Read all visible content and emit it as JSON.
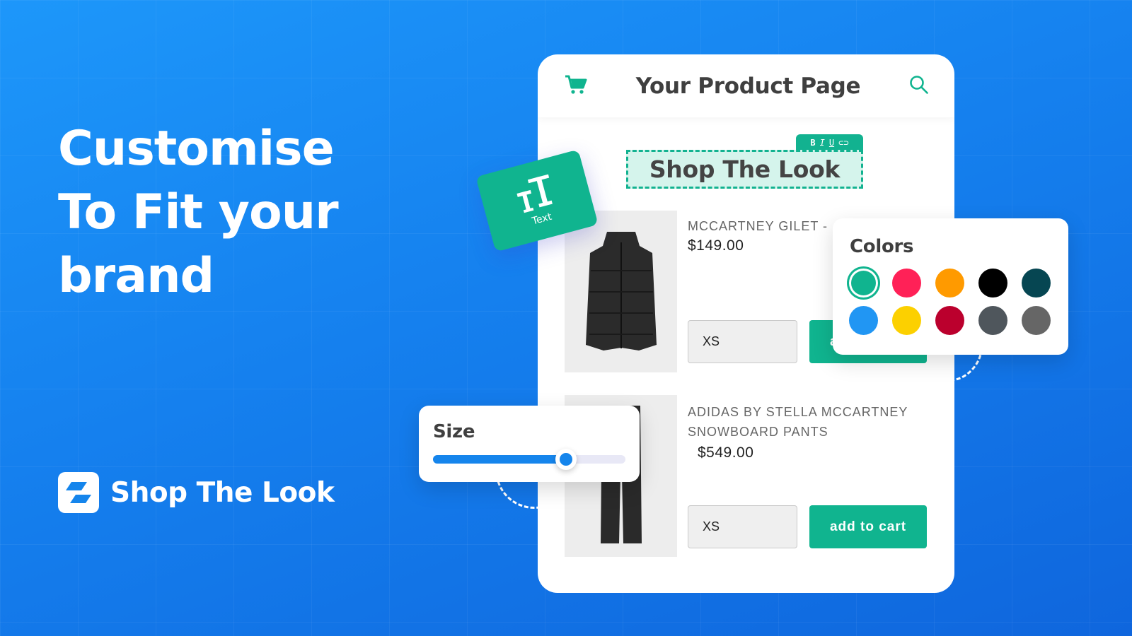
{
  "headline": [
    "Customise",
    "To Fit your",
    "brand"
  ],
  "brand": {
    "name": "Shop The Look",
    "icon": "shop-the-look-logo"
  },
  "product_page": {
    "title": "Your Product Page",
    "cart_icon": "cart-icon",
    "search_icon": "search-icon",
    "section_title": "Shop The Look",
    "toolbar": {
      "bold": "B",
      "italic": "I",
      "underline": "U",
      "link": "link-icon"
    },
    "products": [
      {
        "name_lines": [
          "MCCARTNEY GILET -"
        ],
        "price": "$149.00",
        "size": "XS",
        "button": "add to cart",
        "image": "black puffer gilet"
      },
      {
        "name_lines": [
          "ADIDAS BY STELLA MCCARTNEY",
          "SNOWBOARD PANTS"
        ],
        "price": "$549.00",
        "size": "XS",
        "button": "add to cart",
        "image": "black snowboard pants"
      }
    ]
  },
  "text_widget": {
    "label": "Text",
    "icon": "text-size-icon"
  },
  "colors_panel": {
    "title": "Colors",
    "selected": 0,
    "swatches": [
      "#10b48f",
      "#ff2157",
      "#ff9a00",
      "#000000",
      "#064652",
      "#2196f3",
      "#fcd000",
      "#bb002d",
      "#4f565c",
      "#666666"
    ]
  },
  "size_panel": {
    "title": "Size",
    "value_percent": 69
  },
  "theme": {
    "accent": "#10b48f",
    "background": "#1580ee"
  }
}
